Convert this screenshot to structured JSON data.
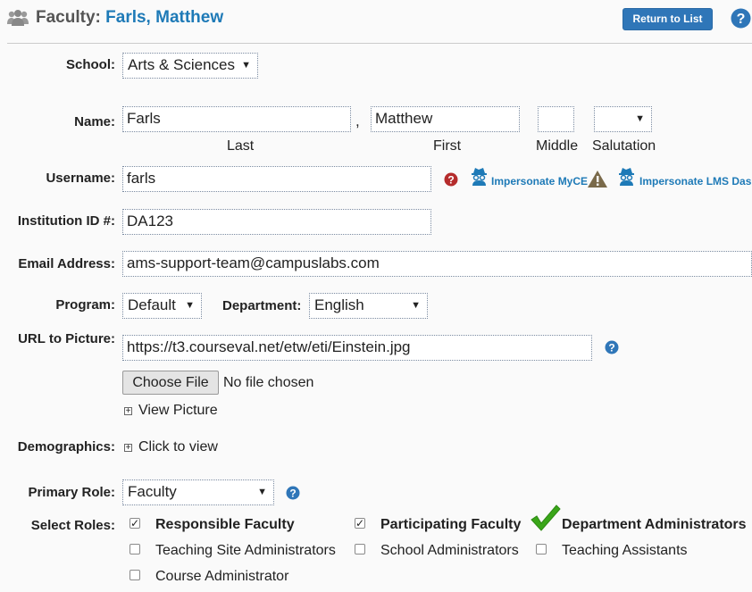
{
  "header": {
    "title_prefix": "Faculty:",
    "title_name": "Farls, Matthew",
    "return_button": "Return to List"
  },
  "school": {
    "label": "School:",
    "value": "Arts & Sciences"
  },
  "name": {
    "label": "Name:",
    "last": "Farls",
    "comma": ",",
    "first": "Matthew",
    "middle": "",
    "salutation": "",
    "last_caption": "Last",
    "first_caption": "First",
    "middle_caption": "Middle",
    "salutation_caption": "Salutation"
  },
  "username": {
    "label": "Username:",
    "value": "farls",
    "impersonate_myce": "Impersonate MyCE",
    "impersonate_lms": "Impersonate LMS Dashb"
  },
  "institution_id": {
    "label": "Institution ID #:",
    "value": "DA123"
  },
  "email": {
    "label": "Email Address:",
    "value": "ams-support-team@campuslabs.com"
  },
  "program": {
    "label": "Program:",
    "value": "Default"
  },
  "department": {
    "label": "Department:",
    "value": "English"
  },
  "picture": {
    "label": "URL to Picture:",
    "value": "https://t3.courseval.net/etw/eti/Einstein.jpg",
    "choose_file": "Choose File",
    "no_file": "No file chosen",
    "view_picture": "View Picture"
  },
  "demographics": {
    "label": "Demographics:",
    "toggle": "Click to view"
  },
  "primary_role": {
    "label": "Primary Role:",
    "value": "Faculty"
  },
  "roles": {
    "label": "Select Roles:",
    "items": [
      {
        "name": "Responsible Faculty",
        "checked": true
      },
      {
        "name": "Participating Faculty",
        "checked": true
      },
      {
        "name": "Department Administrators",
        "checked": true
      },
      {
        "name": "Teaching Site Administrators",
        "checked": false
      },
      {
        "name": "School Administrators",
        "checked": false
      },
      {
        "name": "Teaching Assistants",
        "checked": false
      },
      {
        "name": "Course Administrator",
        "checked": false
      }
    ]
  },
  "colors": {
    "accent": "#1e7ab7",
    "button": "#2f76b8",
    "check_green": "#3aa619"
  }
}
